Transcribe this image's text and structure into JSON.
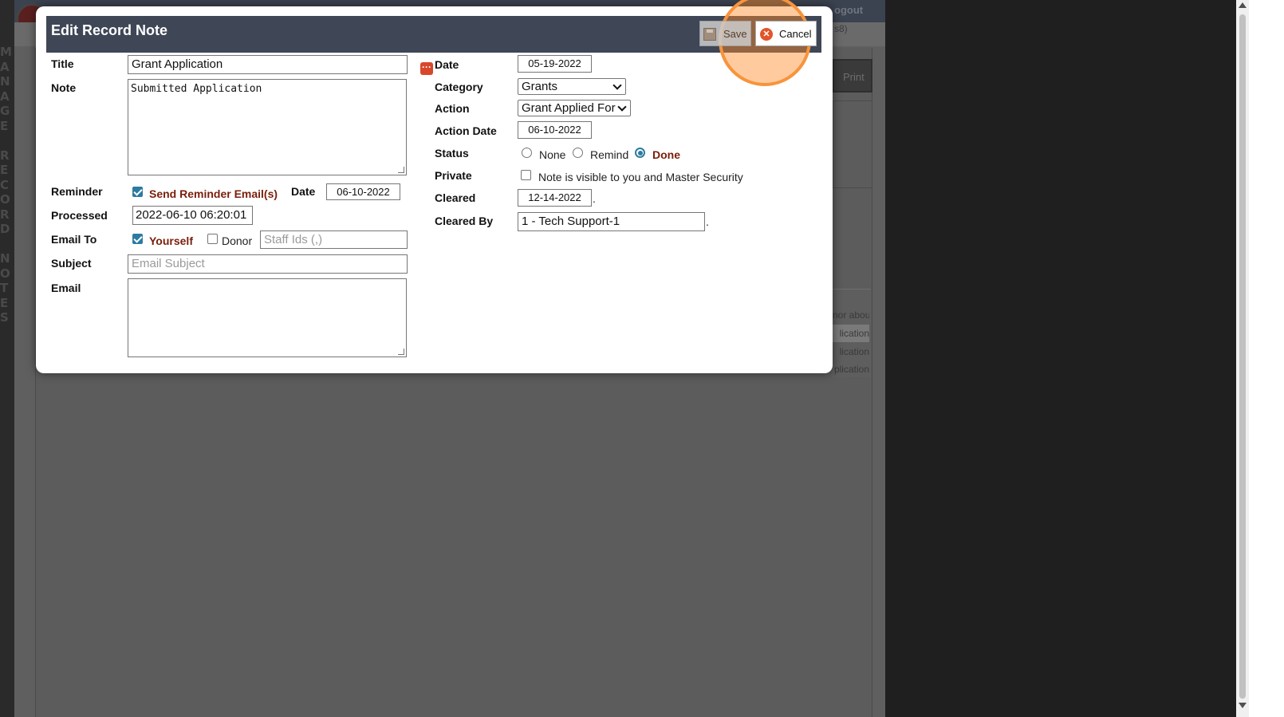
{
  "background": {
    "side_text": "MANAGE RECORD NOTES",
    "header_logout": "ogout",
    "header_id": "s8)",
    "print_label": "Print",
    "rows": [
      "nor abou",
      "lication",
      "lication",
      "plication"
    ]
  },
  "dialog": {
    "title": "Edit Record Note",
    "save_label": "Save",
    "cancel_label": "Cancel",
    "left": {
      "title_label": "Title",
      "title_value": "Grant Application",
      "note_label": "Note",
      "note_value": "Submitted Application",
      "reminder_label": "Reminder",
      "send_reminder_label": "Send Reminder Email(s)",
      "send_reminder_checked": true,
      "date_label": "Date",
      "date_value": "06-10-2022",
      "processed_label": "Processed",
      "processed_value": "2022-06-10 06:20:01",
      "email_to_label": "Email To",
      "yourself_label": "Yourself",
      "yourself_checked": true,
      "donor_label": "Donor",
      "donor_checked": false,
      "staff_ids_placeholder": "Staff Ids (,)",
      "subject_label": "Subject",
      "subject_placeholder": "Email Subject",
      "email_label": "Email"
    },
    "right": {
      "date_label": "Date",
      "date_value": "05-19-2022",
      "category_label": "Category",
      "category_value": "Grants",
      "action_label": "Action",
      "action_value": "Grant Applied For",
      "action_date_label": "Action Date",
      "action_date_value": "06-10-2022",
      "status_label": "Status",
      "status_options": [
        "None",
        "Remind",
        "Done"
      ],
      "status_selected": "Done",
      "private_label": "Private",
      "private_text": "Note is visible to you and Master Security",
      "private_checked": false,
      "cleared_label": "Cleared",
      "cleared_value": "12-14-2022",
      "cleared_by_label": "Cleared By",
      "cleared_by_value": "1 - Tech Support-1",
      "period": "."
    }
  },
  "colors": {
    "titlebar": "#3f4656",
    "highlight": "#f7943c",
    "checkbox_accent": "#2d7ba1",
    "red_text": "#7a1e0a"
  }
}
